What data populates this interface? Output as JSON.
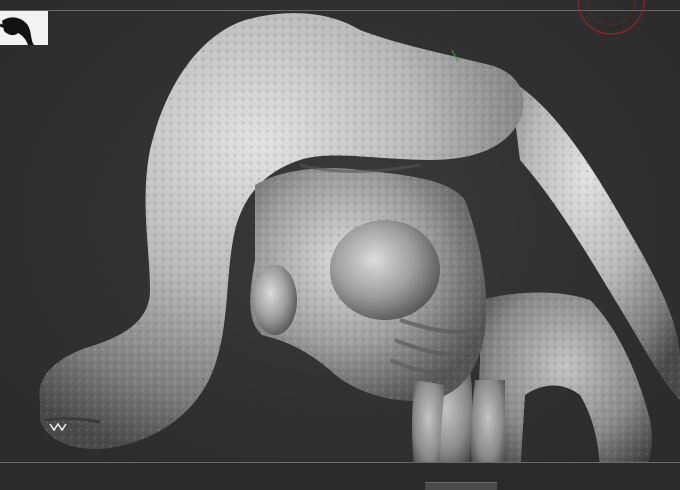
{
  "viewport": {
    "background": "#2e2e2e",
    "frame_line_color": "#6a6a6a"
  },
  "navigator": {
    "icon": "model-silhouette-icon"
  },
  "gizmo": {
    "icon": "rotation-gizmo-icon",
    "color": "#b02020"
  },
  "model": {
    "subject": "sculpted-creature-model",
    "material_color": "#bdbdbd"
  }
}
